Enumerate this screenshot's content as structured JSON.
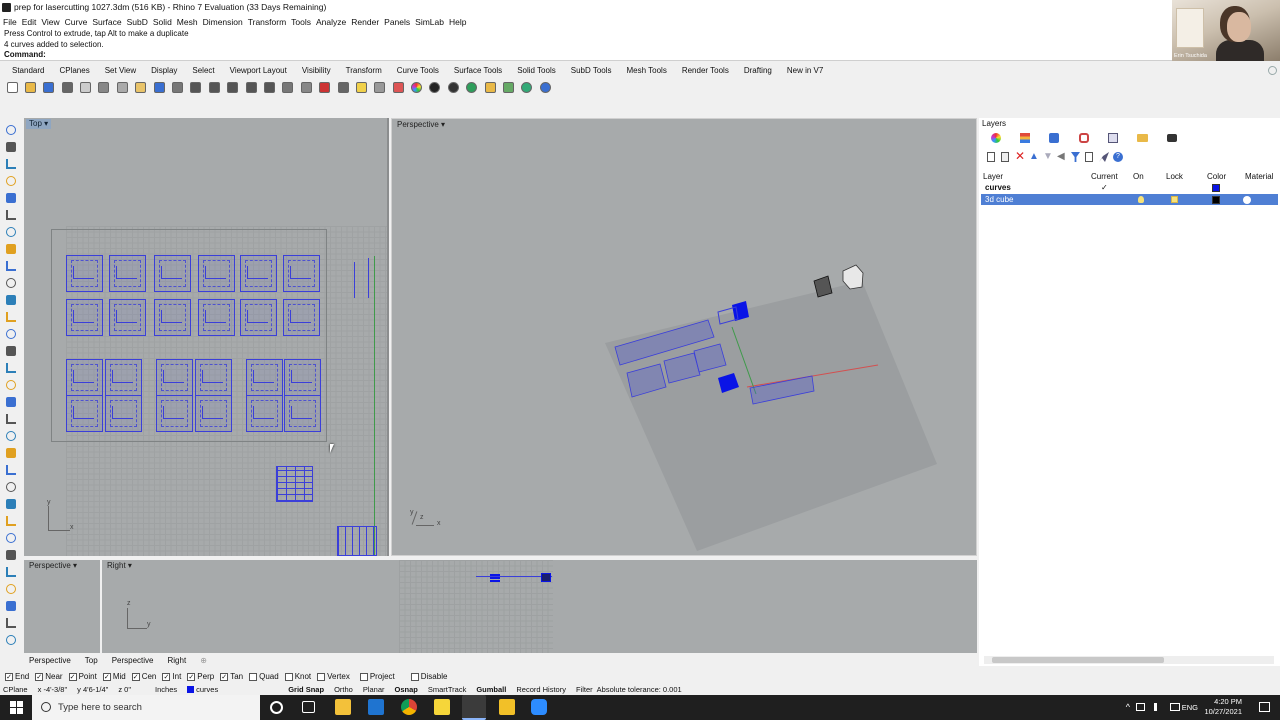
{
  "window": {
    "title": "prep for lasercutting 1027.3dm (516 KB) - Rhino 7 Evaluation (33 Days Remaining)",
    "webcam_name": "Erin Tsuchida"
  },
  "menu": [
    "File",
    "Edit",
    "View",
    "Curve",
    "Surface",
    "SubD",
    "Solid",
    "Mesh",
    "Dimension",
    "Transform",
    "Tools",
    "Analyze",
    "Render",
    "Panels",
    "SimLab",
    "Help"
  ],
  "command": {
    "history": [
      "Press Control to extrude, tap Alt to make a duplicate",
      "4 curves added to selection."
    ],
    "prompt": "Command:"
  },
  "toolbar_tabs": [
    "Standard",
    "CPlanes",
    "Set View",
    "Display",
    "Select",
    "Viewport Layout",
    "Visibility",
    "Transform",
    "Curve Tools",
    "Surface Tools",
    "Solid Tools",
    "SubD Tools",
    "Mesh Tools",
    "Render Tools",
    "Drafting",
    "New in V7"
  ],
  "toolbar_icons": [
    "new-file-icon",
    "open-file-icon",
    "save-icon",
    "print-icon",
    "import-icon",
    "cut-icon",
    "copy-icon",
    "paste-icon",
    "undo-icon",
    "pan-icon",
    "zoom-icon",
    "zoom-window-icon",
    "zoom-selected-icon",
    "zoom-extents-icon",
    "rotate-view-icon",
    "four-viewports-icon",
    "grid-icon",
    "move-icon",
    "rotate-icon",
    "light-bulb-icon",
    "lock-icon",
    "layer-icon",
    "color-circle-icon",
    "material-sphere-icon",
    "render-sphere-icon",
    "globe-icon",
    "star-icon",
    "gear-network-icon",
    "earth-icon",
    "help-icon"
  ],
  "viewports": {
    "top": "Top",
    "perspective": "Perspective",
    "perspective_small": "Perspective",
    "right": "Right",
    "axis_x": "x",
    "axis_y": "y",
    "axis_z": "z"
  },
  "viewport_tabs": [
    "Perspective",
    "Top",
    "Perspective",
    "Right"
  ],
  "layers_panel": {
    "title": "Layers",
    "columns": {
      "layer": "Layer",
      "current": "Current",
      "on": "On",
      "lock": "Lock",
      "color": "Color",
      "material": "Material"
    },
    "rows": [
      {
        "name": "curves",
        "current": "✓",
        "color": "#0a14e6",
        "selected": false
      },
      {
        "name": "3d cube",
        "current": "",
        "color": "#000000",
        "selected": true
      }
    ]
  },
  "osnaps": [
    {
      "label": "End",
      "checked": true
    },
    {
      "label": "Near",
      "checked": true
    },
    {
      "label": "Point",
      "checked": true
    },
    {
      "label": "Mid",
      "checked": true
    },
    {
      "label": "Cen",
      "checked": true
    },
    {
      "label": "Int",
      "checked": true
    },
    {
      "label": "Perp",
      "checked": true
    },
    {
      "label": "Tan",
      "checked": true
    },
    {
      "label": "Quad",
      "checked": false
    },
    {
      "label": "Knot",
      "checked": false
    },
    {
      "label": "Vertex",
      "checked": false
    },
    {
      "label": "Project",
      "checked": false
    },
    {
      "label": "Disable",
      "checked": false
    }
  ],
  "status": {
    "cplane": "CPlane",
    "x": "x -4'-3/8\"",
    "y": "y 4'6-1/4\"",
    "z": "z 0\"",
    "units": "Inches",
    "layer": "curves",
    "grid_snap": "Grid Snap",
    "ortho": "Ortho",
    "planar": "Planar",
    "osnap": "Osnap",
    "smarttrack": "SmartTrack",
    "gumball": "Gumball",
    "record_history": "Record History",
    "filter": "Filter",
    "tolerance": "Absolute tolerance: 0.001"
  },
  "taskbar": {
    "search_placeholder": "Type here to search",
    "lang": "ENG",
    "time": "4:20 PM",
    "date": "10/27/2021"
  },
  "colors": {
    "curve_blue": "#3b3fd9",
    "solid_blue": "#0a14e6",
    "viewport_bg": "#a7aaab"
  }
}
